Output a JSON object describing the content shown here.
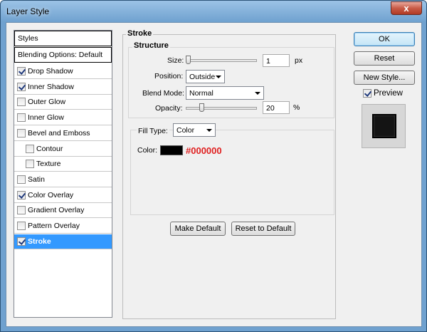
{
  "window": {
    "title": "Layer Style",
    "close_label": "x"
  },
  "styles_list": {
    "header": "Styles",
    "blending": "Blending Options: Default",
    "items": [
      {
        "label": "Drop Shadow",
        "checked": true,
        "indent": false
      },
      {
        "label": "Inner Shadow",
        "checked": true,
        "indent": false
      },
      {
        "label": "Outer Glow",
        "checked": false,
        "indent": false
      },
      {
        "label": "Inner Glow",
        "checked": false,
        "indent": false
      },
      {
        "label": "Bevel and Emboss",
        "checked": false,
        "indent": false
      },
      {
        "label": "Contour",
        "checked": false,
        "indent": true
      },
      {
        "label": "Texture",
        "checked": false,
        "indent": true
      },
      {
        "label": "Satin",
        "checked": false,
        "indent": false
      },
      {
        "label": "Color Overlay",
        "checked": true,
        "indent": false
      },
      {
        "label": "Gradient Overlay",
        "checked": false,
        "indent": false
      },
      {
        "label": "Pattern Overlay",
        "checked": false,
        "indent": false
      },
      {
        "label": "Stroke",
        "checked": true,
        "indent": false,
        "selected": true
      }
    ]
  },
  "stroke": {
    "title": "Stroke",
    "structure_title": "Structure",
    "size_label": "Size:",
    "size_value": "1",
    "size_unit": "px",
    "size_slider_fraction": 0.0,
    "position_label": "Position:",
    "position_value": "Outside",
    "blend_label": "Blend Mode:",
    "blend_value": "Normal",
    "opacity_label": "Opacity:",
    "opacity_value": "20",
    "opacity_unit": "%",
    "opacity_slider_fraction": 0.2,
    "fill_type_label": "Fill Type:",
    "fill_type_value": "Color",
    "color_label": "Color:",
    "color_value": "#000000",
    "make_default": "Make Default",
    "reset_default": "Reset to Default"
  },
  "buttons": {
    "ok": "OK",
    "reset": "Reset",
    "new_style": "New Style...",
    "preview_label": "Preview",
    "preview_checked": true
  },
  "colors": {
    "selection": "#3399ff",
    "hex_text": "#e02020",
    "swatch": "#000000"
  }
}
